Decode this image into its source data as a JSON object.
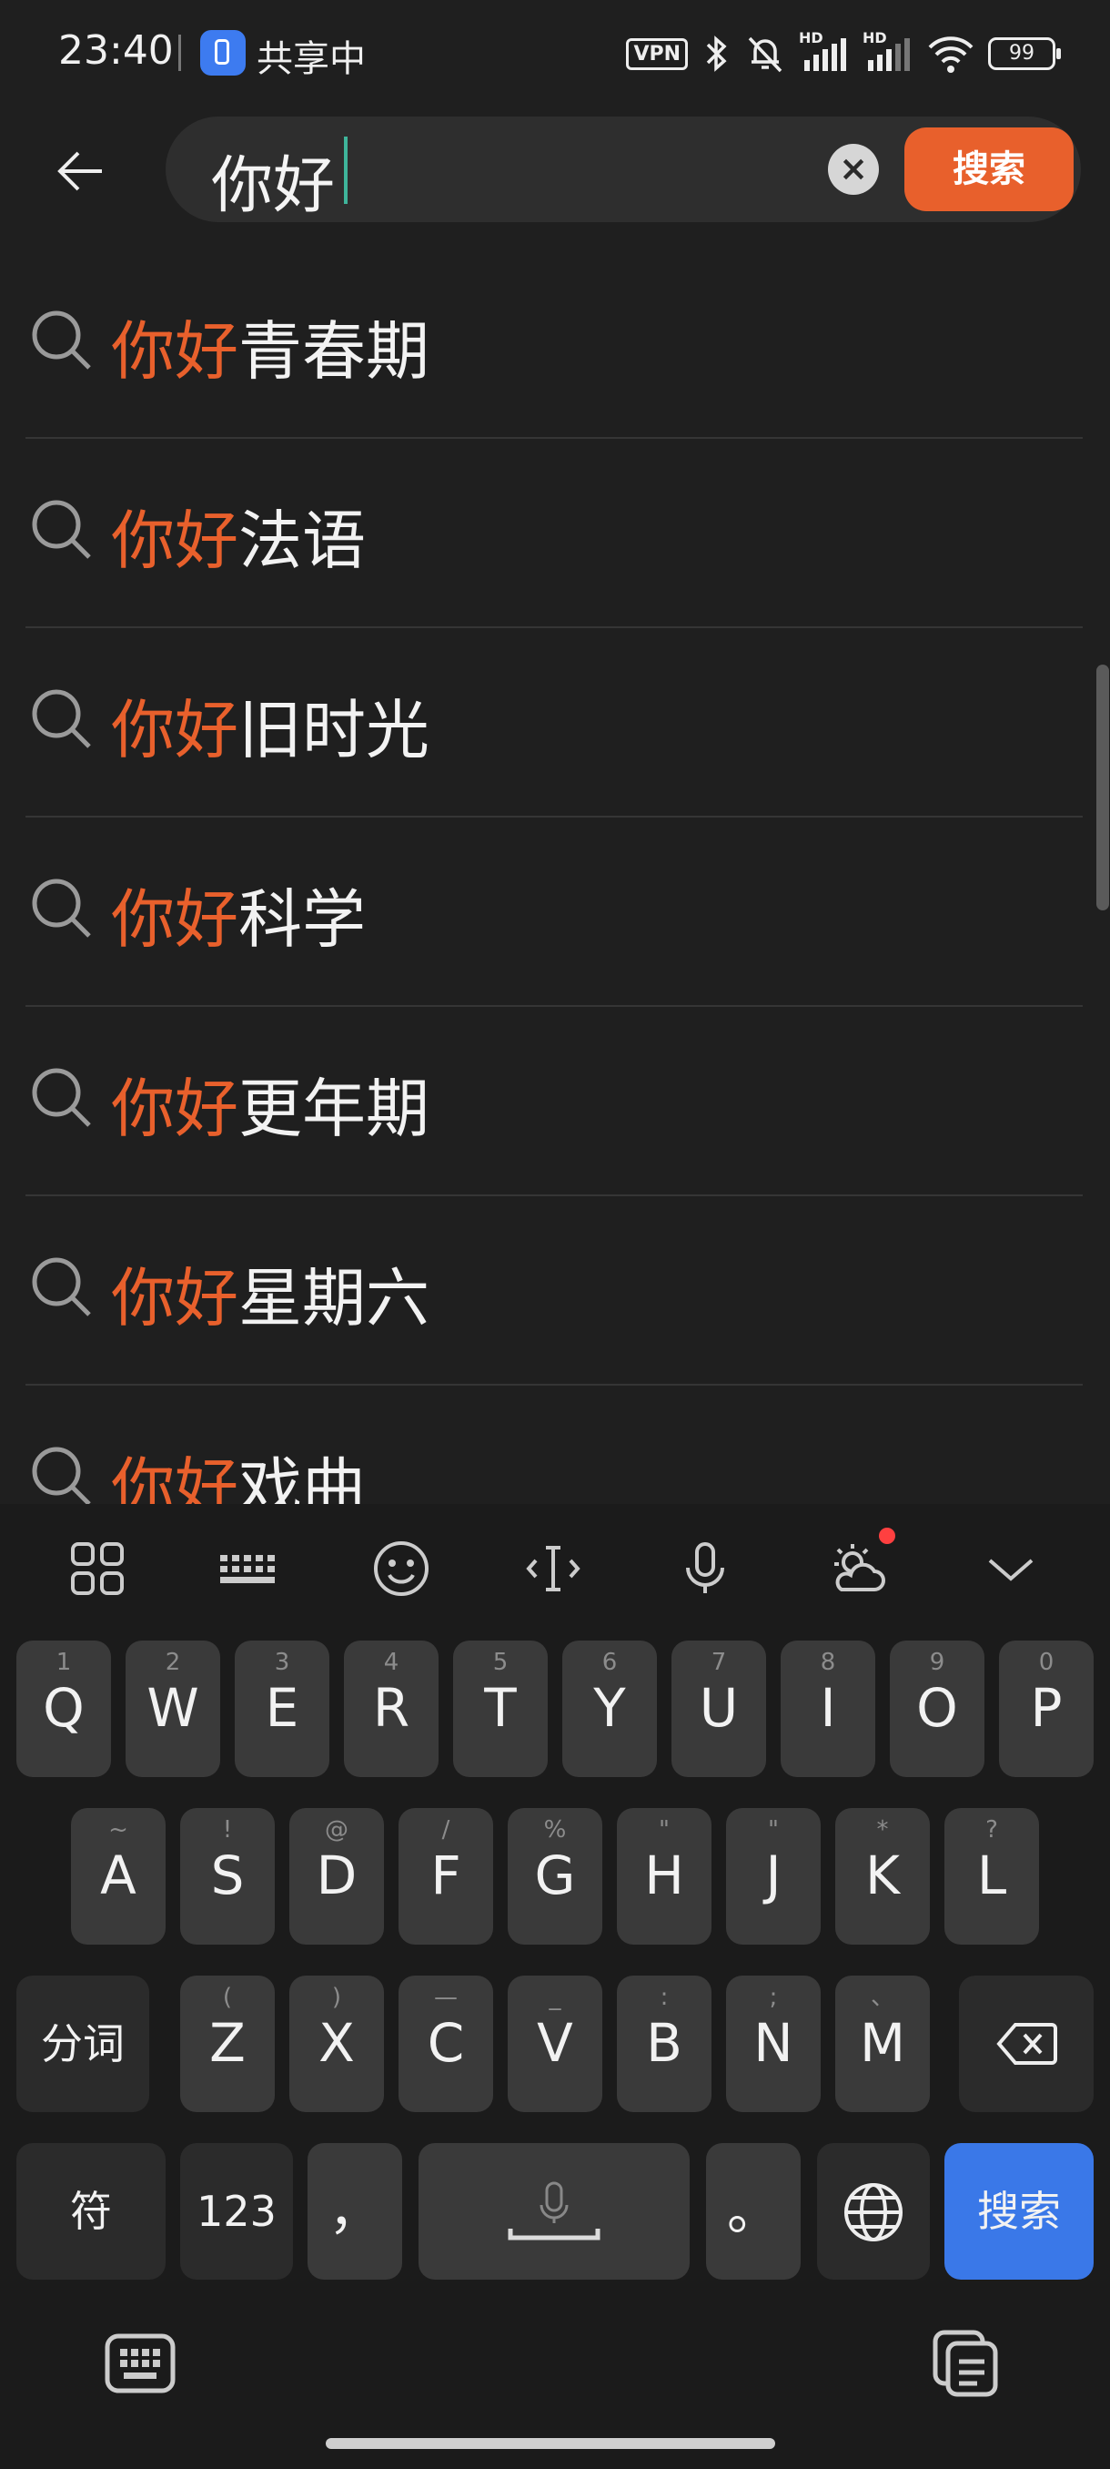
{
  "status_bar": {
    "time": "23:40",
    "sharing_label": "共享中",
    "vpn_label": "VPN",
    "network_1": "HD",
    "network_2": "HD",
    "battery": "99"
  },
  "search": {
    "query": "你好",
    "search_button_label": "搜索"
  },
  "suggestions": [
    {
      "highlight": "你好",
      "rest": "青春期"
    },
    {
      "highlight": "你好",
      "rest": "法语"
    },
    {
      "highlight": "你好",
      "rest": "旧时光"
    },
    {
      "highlight": "你好",
      "rest": "科学"
    },
    {
      "highlight": "你好",
      "rest": "更年期"
    },
    {
      "highlight": "你好",
      "rest": "星期六"
    },
    {
      "highlight": "你好",
      "rest": "戏曲"
    }
  ],
  "keyboard": {
    "toolbar_icons": [
      "apps-grid-icon",
      "keyboard-layout-icon",
      "emoji-icon",
      "text-cursor-icon",
      "microphone-icon",
      "weather-icon",
      "collapse-chevron-icon"
    ],
    "row1": [
      {
        "main": "Q",
        "sub": "1"
      },
      {
        "main": "W",
        "sub": "2"
      },
      {
        "main": "E",
        "sub": "3"
      },
      {
        "main": "R",
        "sub": "4"
      },
      {
        "main": "T",
        "sub": "5"
      },
      {
        "main": "Y",
        "sub": "6"
      },
      {
        "main": "U",
        "sub": "7"
      },
      {
        "main": "I",
        "sub": "8"
      },
      {
        "main": "O",
        "sub": "9"
      },
      {
        "main": "P",
        "sub": "0"
      }
    ],
    "row2": [
      {
        "main": "A",
        "sub": "~"
      },
      {
        "main": "S",
        "sub": "!"
      },
      {
        "main": "D",
        "sub": "@"
      },
      {
        "main": "F",
        "sub": "/"
      },
      {
        "main": "G",
        "sub": "%"
      },
      {
        "main": "H",
        "sub": "\""
      },
      {
        "main": "J",
        "sub": "\""
      },
      {
        "main": "K",
        "sub": "*"
      },
      {
        "main": "L",
        "sub": "?"
      }
    ],
    "row3_left": "分词",
    "row3": [
      {
        "main": "Z",
        "sub": "("
      },
      {
        "main": "X",
        "sub": ")"
      },
      {
        "main": "C",
        "sub": "—"
      },
      {
        "main": "V",
        "sub": "_"
      },
      {
        "main": "B",
        "sub": ":"
      },
      {
        "main": "N",
        "sub": ";"
      },
      {
        "main": "M",
        "sub": "、"
      }
    ],
    "row4": {
      "symbols": "符",
      "numbers": "123",
      "comma": "，",
      "period": "。",
      "enter": "搜索"
    }
  }
}
